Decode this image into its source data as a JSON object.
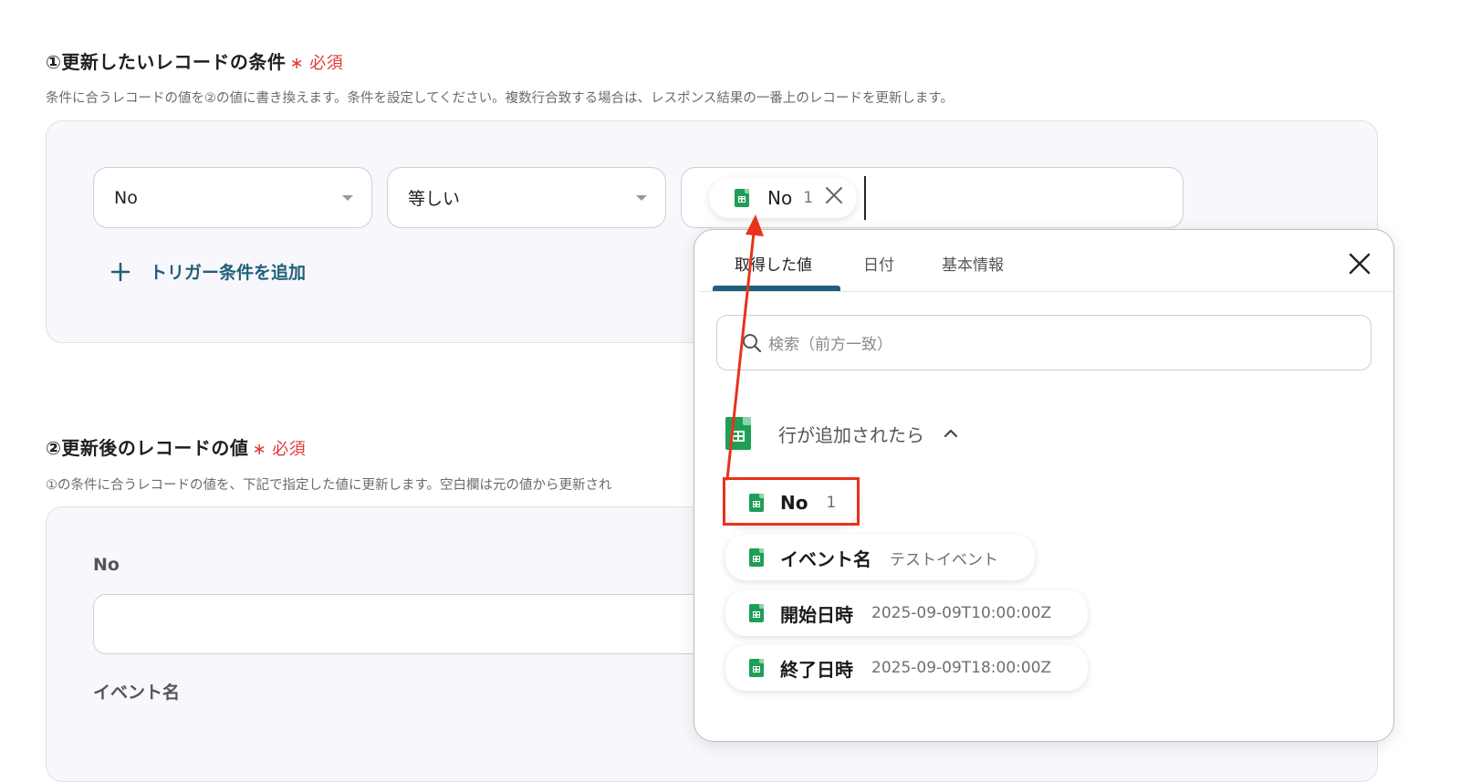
{
  "section1": {
    "title": "①更新したいレコードの条件",
    "required_mark": "∗",
    "required_label": "必須",
    "description": "条件に合うレコードの値を②の値に書き換えます。条件を設定してください。複数行合致する場合は、レスポンス結果の一番上のレコードを更新します。",
    "condition": {
      "field_value": "No",
      "operator_value": "等しい",
      "value_chip": {
        "label": "No",
        "value": "1"
      }
    },
    "add_condition_label": "トリガー条件を追加"
  },
  "section2": {
    "title": "②更新後のレコードの値",
    "required_mark": "∗",
    "required_label": "必須",
    "description": "①の条件に合うレコードの値を、下記で指定した値に更新します。空白欄は元の値から更新され",
    "fields": [
      {
        "label": "No",
        "value": ""
      },
      {
        "label": "イベント名"
      }
    ]
  },
  "popup": {
    "tabs": [
      {
        "label": "取得した値",
        "active": true
      },
      {
        "label": "日付",
        "active": false
      },
      {
        "label": "基本情報",
        "active": false
      }
    ],
    "search_placeholder": "検索（前方一致）",
    "group_title": "行が追加されたら",
    "items": [
      {
        "label": "No",
        "value": "1",
        "highlighted": true
      },
      {
        "label": "イベント名",
        "value": "テストイベント"
      },
      {
        "label": "開始日時",
        "value": "2025-09-09T10:00:00Z"
      },
      {
        "label": "終了日時",
        "value": "2025-09-09T18:00:00Z"
      }
    ]
  },
  "colors": {
    "accent_tab": "#1f5f7a",
    "add_link": "#1f5f7a",
    "required": "#e53935",
    "highlight_box": "#e8321c",
    "arrow": "#e8321c",
    "sheets_green": "#1e9e56"
  },
  "icons": [
    "spreadsheet-icon",
    "close-icon",
    "search-icon",
    "chevron-up-icon",
    "plus-icon",
    "dropdown-caret-icon"
  ]
}
